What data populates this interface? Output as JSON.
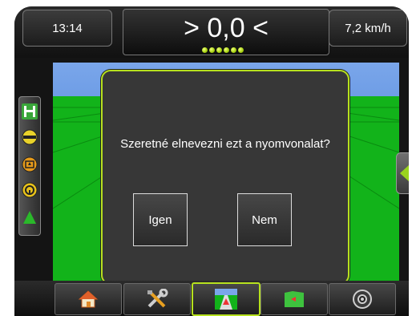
{
  "header": {
    "time": "13:14",
    "cross_track": "> 0,0 <",
    "speed": "7,2 km/h",
    "lightbar_leds": 6
  },
  "left_toolbar": {
    "icons": [
      "guidance-mode-icon",
      "swath-line-icon",
      "marker-icon",
      "steering-icon",
      "implement-icon"
    ]
  },
  "right_tab": {
    "icon": "expand-left-arrow-icon"
  },
  "dialog": {
    "question": "Szeretné elnevezni ezt a nyomvonalat?",
    "yes_label": "Igen",
    "no_label": "Nem"
  },
  "bottom_nav": {
    "items": [
      "home-icon",
      "tools-icon",
      "guidance-view-icon",
      "field-map-icon",
      "gauge-icon"
    ],
    "active_index": 2
  },
  "colors": {
    "accent": "#b6e11e",
    "field": "#12b31a",
    "sky": "#7aa6ea",
    "dialog_bg": "#373737"
  }
}
